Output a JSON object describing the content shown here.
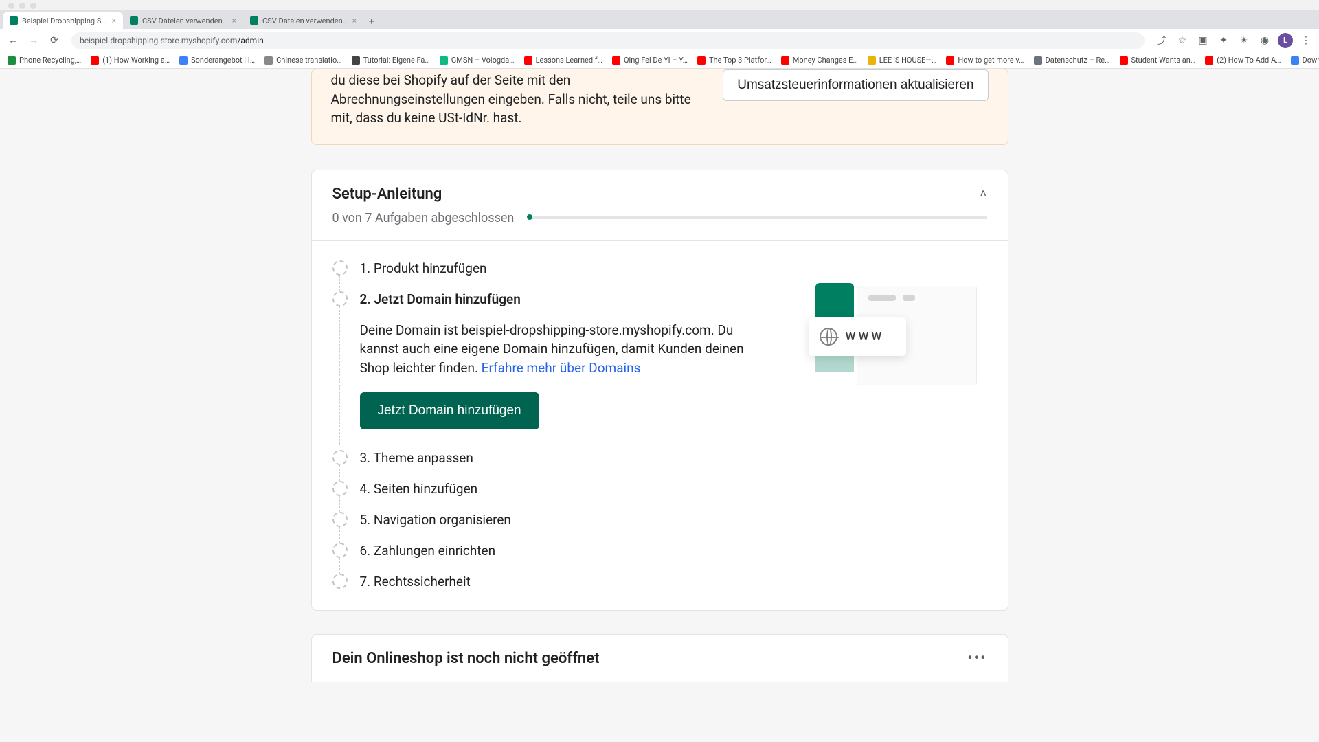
{
  "browser": {
    "tabs": [
      {
        "title": "Beispiel Dropshipping Store · H…",
        "active": true
      },
      {
        "title": "CSV-Dateien verwenden, um P…",
        "active": false
      },
      {
        "title": "CSV-Dateien verwenden, um P…",
        "active": false
      }
    ],
    "url_domain": "beispiel-dropshipping-store.myshopify.com",
    "url_path": "/admin",
    "bookmarks": [
      {
        "label": "Phone Recycling,…",
        "color": "#1a8f3e"
      },
      {
        "label": "(1) How Working a…",
        "color": "#ff0000"
      },
      {
        "label": "Sonderangebot | I…",
        "color": "#3b82f6"
      },
      {
        "label": "Chinese translatio…",
        "color": "#888"
      },
      {
        "label": "Tutorial: Eigene Fa…",
        "color": "#444"
      },
      {
        "label": "GMSN – Vologda…",
        "color": "#10b981"
      },
      {
        "label": "Lessons Learned f…",
        "color": "#ff0000"
      },
      {
        "label": "Qing Fei De Yi – Y…",
        "color": "#ff0000"
      },
      {
        "label": "The Top 3 Platfor…",
        "color": "#ff0000"
      },
      {
        "label": "Money Changes E…",
        "color": "#ff0000"
      },
      {
        "label": "LEE 'S HOUSE—…",
        "color": "#eab308"
      },
      {
        "label": "How to get more v…",
        "color": "#ff0000"
      },
      {
        "label": "Datenschutz – Re…",
        "color": "#6b7280"
      },
      {
        "label": "Student Wants an…",
        "color": "#ff0000"
      },
      {
        "label": "(2) How To Add A…",
        "color": "#ff0000"
      },
      {
        "label": "Download – Cooki…",
        "color": "#3b82f6"
      }
    ]
  },
  "tax_notice": {
    "body": "du diese bei Shopify auf der Seite mit den Abrechnungseinstellungen eingeben. Falls nicht, teile uns bitte mit, dass du keine USt-IdNr. hast.",
    "button_label": "Umsatzsteuerinformationen aktualisieren"
  },
  "setup": {
    "title": "Setup-Anleitung",
    "progress_text": "0 von 7 Aufgaben abgeschlossen",
    "steps": {
      "s1": {
        "title": "1. Produkt hinzufügen"
      },
      "s2": {
        "title": "2. Jetzt Domain hinzufügen",
        "desc": "Deine Domain ist beispiel-dropshipping-store.myshopify.com. Du kannst auch eine eigene Domain hinzufügen, damit Kunden deinen Shop leichter finden. ",
        "link_label": "Erfahre mehr über Domains",
        "button_label": "Jetzt Domain hinzufügen",
        "www_label": "WWW"
      },
      "s3": {
        "title": "3. Theme anpassen"
      },
      "s4": {
        "title": "4. Seiten hinzufügen"
      },
      "s5": {
        "title": "5. Navigation organisieren"
      },
      "s6": {
        "title": "6. Zahlungen einrichten"
      },
      "s7": {
        "title": "7. Rechtssicherheit"
      }
    }
  },
  "shop_status": {
    "title": "Dein Onlineshop ist noch nicht geöffnet"
  }
}
